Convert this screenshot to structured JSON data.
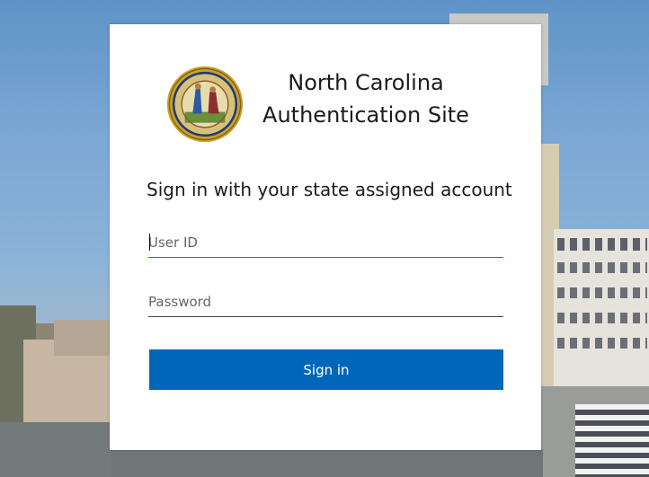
{
  "header": {
    "title_line1": "North Carolina",
    "title_line2": "Authentication Site"
  },
  "form": {
    "subtitle": "Sign in with your state assigned account",
    "userid_placeholder": "User ID",
    "userid_value": "",
    "password_placeholder": "Password",
    "password_value": "",
    "signin_label": "Sign in"
  },
  "colors": {
    "accent": "#0067b8",
    "active_underline": "#1f6fb5"
  },
  "icons": {
    "seal": "nc-state-seal-icon"
  }
}
